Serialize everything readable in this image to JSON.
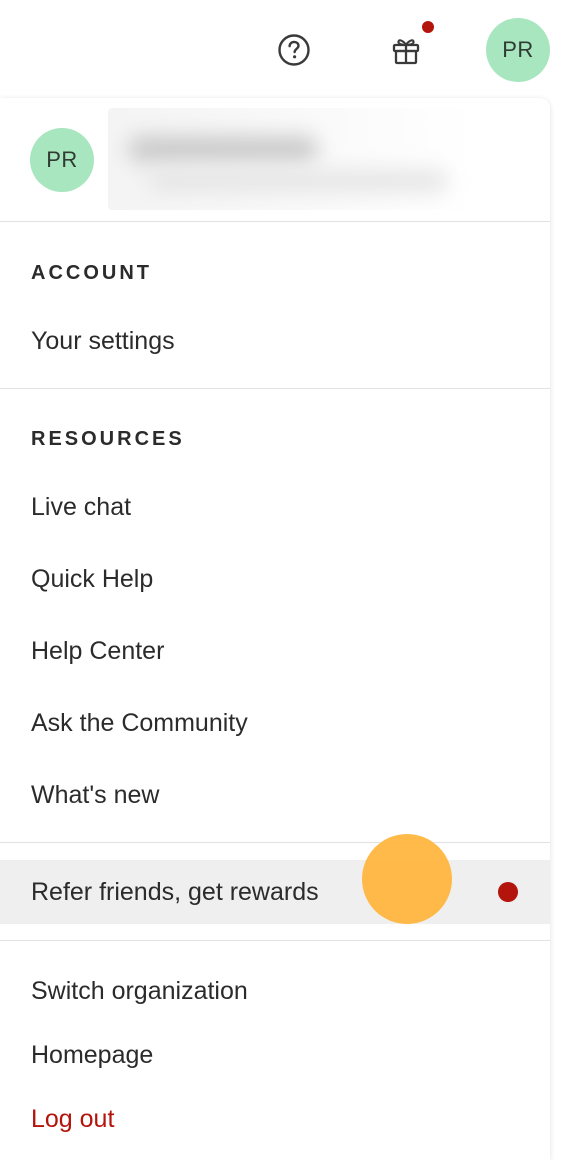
{
  "topbar": {
    "help_icon": "question-circle-icon",
    "gift_icon": "gift-icon",
    "user_initials": "PR"
  },
  "menu": {
    "header": {
      "user_initials": "PR"
    },
    "account": {
      "title": "ACCOUNT",
      "items": [
        {
          "label": "Your settings"
        }
      ]
    },
    "resources": {
      "title": "RESOURCES",
      "items": [
        {
          "label": "Live chat"
        },
        {
          "label": "Quick Help"
        },
        {
          "label": "Help Center"
        },
        {
          "label": "Ask the Community"
        },
        {
          "label": "What's new"
        }
      ]
    },
    "referral": {
      "label": "Refer friends, get rewards"
    },
    "footer": {
      "items": [
        {
          "label": "Switch organization"
        },
        {
          "label": "Homepage"
        },
        {
          "label": "Log out"
        }
      ]
    }
  },
  "colors": {
    "avatar_bg": "#a8e6bf",
    "notification_dot": "#b3140b",
    "logout_text": "#b3140b",
    "highlight_bg": "#efefef",
    "cursor": "#ffb43a"
  }
}
